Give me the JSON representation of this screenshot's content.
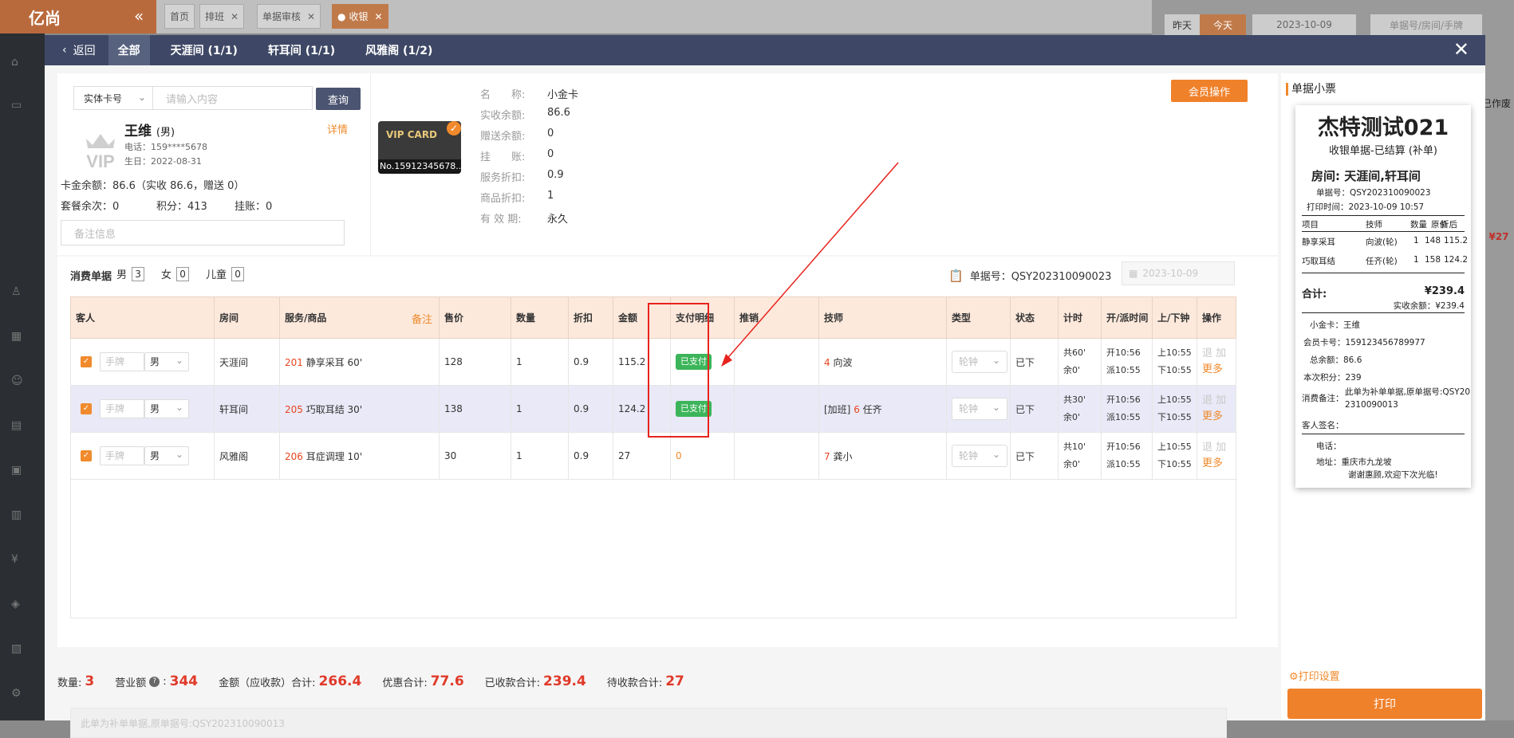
{
  "bg": {
    "logo": "亿尚",
    "tabs": [
      {
        "label": "首页"
      },
      {
        "label": "排班"
      },
      {
        "label": "单据审核"
      },
      {
        "label": "收银"
      }
    ],
    "side": [
      "首页",
      "前台",
      "收银",
      "办卡",
      "充值",
      "补单",
      "迎宾",
      "预约",
      "会员",
      "吧台",
      "进销",
      "单据",
      "财务",
      "连锁",
      "基础",
      "系统"
    ],
    "yesterday": "昨天",
    "today": "今天",
    "date": "2023-10-09",
    "search_ph": "单据号/房间/手牌",
    "right_a": "已作废",
    "right_b": "¥27"
  },
  "header": {
    "back": "返回",
    "tabs": [
      {
        "label": "全部"
      },
      {
        "label": "天涯间 (1/1)"
      },
      {
        "label": "轩耳间 (1/1)"
      },
      {
        "label": "风雅阁 (1/2)"
      }
    ],
    "close": "✕"
  },
  "search": {
    "type": "实体卡号",
    "placeholder": "请输入内容",
    "button": "查询"
  },
  "member": {
    "name": "王维",
    "gender": "(男)",
    "detail": "详情",
    "phone": "电话：159****5678",
    "birthday": "生日：2022-08-31",
    "card_balance": "卡金余额：86.6（实收 86.6，赠送 0）",
    "package": "套餐余次：0",
    "points": "积分：413",
    "credit": "挂账：0",
    "remark_ph": "备注信息"
  },
  "card": {
    "title": "VIP CARD",
    "no": "No.15912345678...",
    "check": "✓",
    "fields": [
      {
        "k": "名　　称:",
        "v": "小金卡"
      },
      {
        "k": "实收余额:",
        "v": "86.6"
      },
      {
        "k": "赠送余额:",
        "v": "0"
      },
      {
        "k": "挂　　账:",
        "v": "0"
      },
      {
        "k": "服务折扣:",
        "v": "0.9"
      },
      {
        "k": "商品折扣:",
        "v": "1"
      },
      {
        "k": "有 效 期:",
        "v": "永久"
      }
    ]
  },
  "member_op": "会员操作",
  "consume": {
    "title": "消费单据",
    "male_label": "男",
    "male": "3",
    "female_label": "女",
    "female": "0",
    "child_label": "儿童",
    "child": "0",
    "bill_no": "单据号：QSY202310090023",
    "date_ph": "2023-10-09"
  },
  "table": {
    "headers": [
      "客人",
      "房间",
      "服务/商品",
      "售价",
      "数量",
      "折扣",
      "金额",
      "支付明细",
      "推销",
      "技师",
      "类型",
      "状态",
      "计时",
      "开/派时间",
      "上/下钟",
      "操作"
    ],
    "remark_label": "备注",
    "rows": [
      {
        "hand": "手牌",
        "gender": "男",
        "room": "天涯间",
        "code": "201",
        "service": "静享采耳 60'",
        "price": "128",
        "qty": "1",
        "disc": "0.9",
        "amount": "115.2",
        "pay": "已支付",
        "promo": "",
        "tech_prefix": "",
        "tech_no": "4",
        "tech": "向波",
        "type": "轮钟",
        "status": "已下",
        "timer1": "共60'",
        "timer2": "余0'",
        "t1": "开10:56",
        "t2": "派10:55",
        "c1": "上10:55",
        "c2": "下10:55",
        "op1": "退",
        "op2": "加",
        "op3": "更多"
      },
      {
        "hand": "手牌",
        "gender": "男",
        "room": "轩耳间",
        "code": "205",
        "service": "巧取耳结 30'",
        "price": "138",
        "qty": "1",
        "disc": "0.9",
        "amount": "124.2",
        "pay": "已支付",
        "promo": "",
        "tech_prefix": "[加班]",
        "tech_no": "6",
        "tech": "任齐",
        "type": "轮钟",
        "status": "已下",
        "timer1": "共30'",
        "timer2": "余0'",
        "t1": "开10:56",
        "t2": "派10:55",
        "c1": "上10:55",
        "c2": "下10:55",
        "op1": "退",
        "op2": "加",
        "op3": "更多"
      },
      {
        "hand": "手牌",
        "gender": "男",
        "room": "风雅阁",
        "code": "206",
        "service": "耳症调理 10'",
        "price": "30",
        "qty": "1",
        "disc": "0.9",
        "amount": "27",
        "pay": "0",
        "promo": "",
        "tech_prefix": "",
        "tech_no": "7",
        "tech": "龚小",
        "type": "轮钟",
        "status": "已下",
        "timer1": "共10'",
        "timer2": "余0'",
        "t1": "开10:56",
        "t2": "派10:55",
        "c1": "上10:55",
        "c2": "下10:55",
        "op1": "退",
        "op2": "加",
        "op3": "更多"
      }
    ]
  },
  "totals": {
    "qty_l": "数量:",
    "qty": "3",
    "rev_l": "营业额",
    "rev_c": ":",
    "rev": "344",
    "amt_l": "金额（应收款）合计:",
    "amt": "266.4",
    "disc_l": "优惠合计:",
    "disc": "77.6",
    "recv_l": "已收款合计:",
    "recv": "239.4",
    "pend_l": "待收款合计:",
    "pend": "27"
  },
  "note": "此单为补单单据,原单据号:QSY202310090013",
  "receipt": {
    "panel_title": "单据小票",
    "shop": "杰特测试021",
    "subtitle": "收银单据-已结算 (补单)",
    "room": "房间:  天涯间,轩耳间",
    "bill_no": "单据号：QSY202310090023",
    "print_time": "打印时间：2023-10-09 10:57",
    "cols": [
      "项目",
      "技师",
      "数量",
      "原价",
      "折后"
    ],
    "items": [
      {
        "name": "静享采耳",
        "tech": "向波(轮)",
        "qty": "1",
        "price": "148",
        "after": "115.2"
      },
      {
        "name": "巧取耳结",
        "tech": "任齐(轮)",
        "qty": "1",
        "price": "158",
        "after": "124.2"
      }
    ],
    "total_l": "合计:",
    "total": "¥239.4",
    "received": "实收余额：¥239.4",
    "card_l": "小金卡：",
    "card": "王维",
    "cardno_l": "会员卡号：",
    "cardno": "159123456789977",
    "bal_l": "总余额：",
    "bal": "86.6",
    "pts_l": "本次积分：",
    "pts": "239",
    "remark_l": "消费备注：",
    "remark1": "此单为补单单据,原单据号:QSY20",
    "remark2": "2310090013",
    "sign_l": "客人签名：",
    "tel_l": "电话：",
    "addr_l": "地址：",
    "addr": "重庆市九龙坡",
    "thanks": "谢谢惠顾,欢迎下次光临!"
  },
  "print_settings": "⚙打印设置",
  "print_btn": "打印",
  "colors": {
    "accent": "#f08a2c",
    "header": "#3e4866",
    "paid": "#3cb55a",
    "red": "#e8231d"
  }
}
